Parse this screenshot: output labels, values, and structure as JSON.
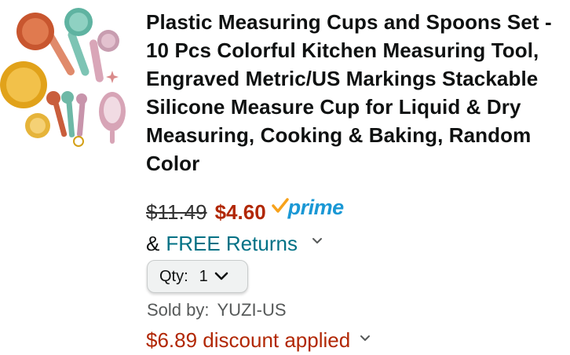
{
  "product": {
    "title": "Plastic Measuring Cups and Spoons Set - 10 Pcs Colorful Kitchen Measuring Tool, Engraved Metric/US Markings Stackable Silicone Measure Cup for Liquid & Dry Measuring, Cooking & Baking, Random Color",
    "image_icon": "measuring-cups-image"
  },
  "pricing": {
    "original_price": "$11.49",
    "sale_price": "$4.60",
    "prime_label": "prime",
    "prime_icon": "prime-check-icon"
  },
  "returns": {
    "ampersand": "&",
    "label": "FREE Returns",
    "icon": "chevron-down-icon"
  },
  "quantity": {
    "label": "Qty:",
    "value": "1",
    "icon": "chevron-down-icon"
  },
  "seller": {
    "label": "Sold by:",
    "name": "YUZI-US"
  },
  "discount": {
    "text": "$6.89 discount applied",
    "icon": "chevron-down-icon"
  },
  "colors": {
    "title": "#0f1111",
    "sale_price": "#b12704",
    "link": "#007185",
    "prime": "#1a98d5",
    "prime_check": "#f7a21b",
    "muted": "#565959"
  }
}
